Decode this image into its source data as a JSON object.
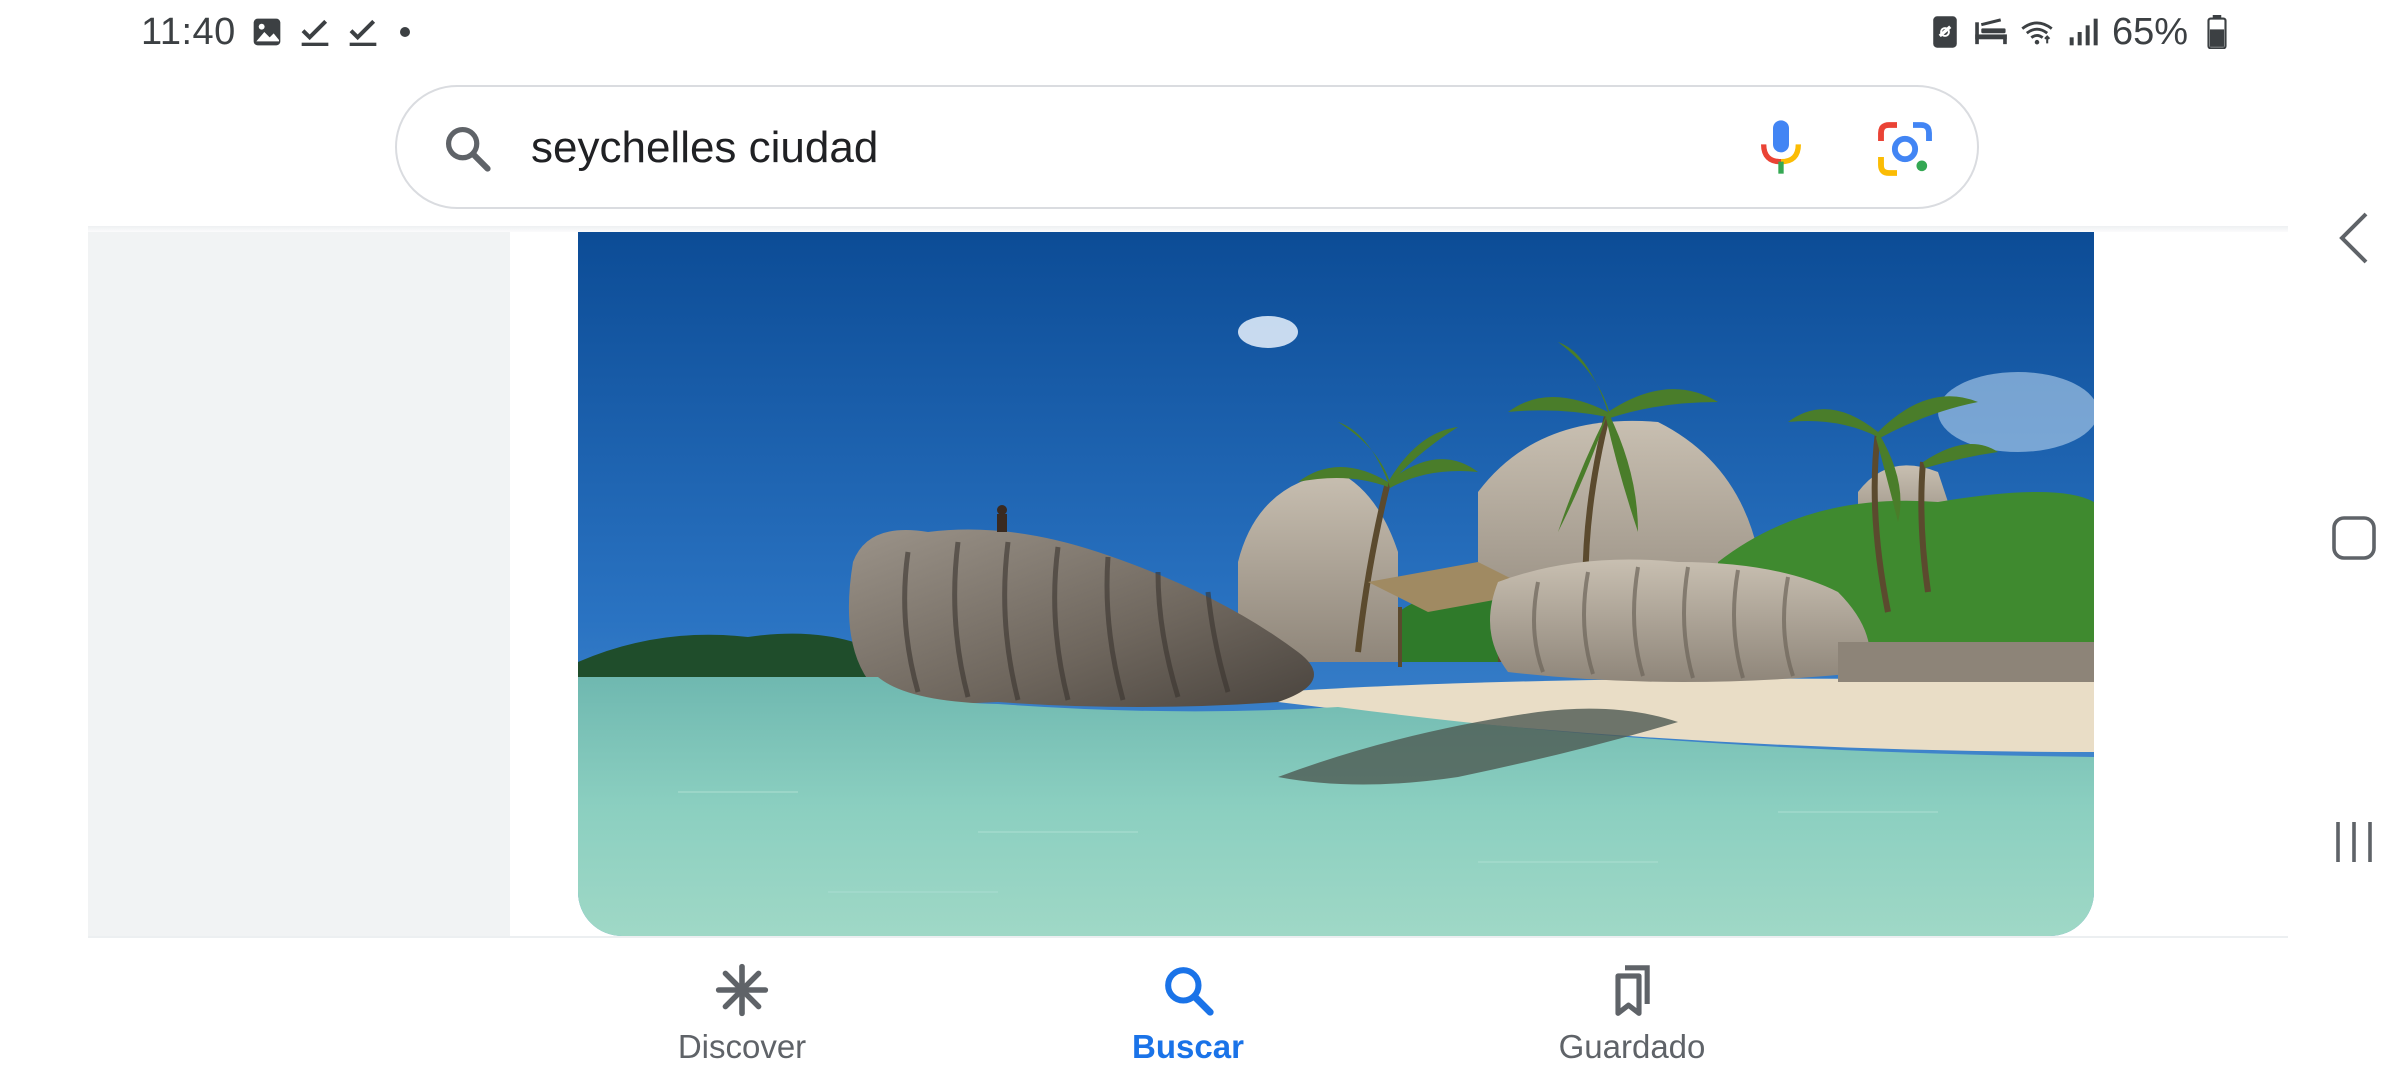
{
  "status_bar": {
    "time": "11:40",
    "left_icons": [
      "gallery-icon",
      "check-icon",
      "check-icon",
      "dot-icon"
    ],
    "right_icons": [
      "nfc-icon",
      "bed-icon",
      "wifi-icon",
      "signal-icon",
      "battery-icon"
    ],
    "battery": "65%",
    "battery_level": 0.65
  },
  "search": {
    "query": "seychelles ciudad",
    "icons": [
      "search-icon",
      "mic-icon",
      "google-lens-icon"
    ]
  },
  "colors": {
    "accent": "#1a73e8",
    "inactive": "#5f6368",
    "panel": "#f1f3f4"
  },
  "bottom_nav": {
    "items": [
      {
        "label": "Discover",
        "icon": "asterisk-icon",
        "active": false
      },
      {
        "label": "Buscar",
        "icon": "search-icon",
        "active": true
      },
      {
        "label": "Guardado",
        "icon": "bookmark-icon",
        "active": false
      }
    ]
  },
  "system_nav": [
    "back-icon",
    "home-icon",
    "recent-apps-icon"
  ]
}
